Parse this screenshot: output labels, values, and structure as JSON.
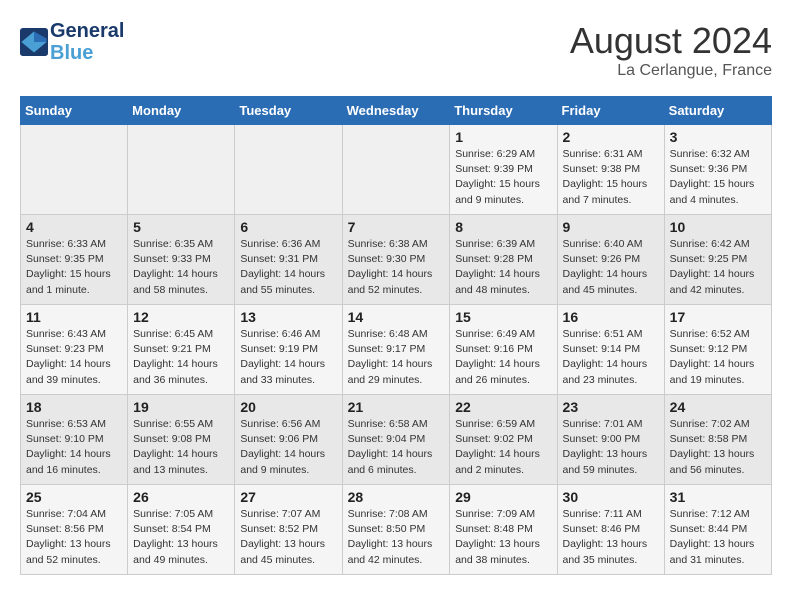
{
  "header": {
    "logo_line1": "General",
    "logo_line2": "Blue",
    "month": "August 2024",
    "location": "La Cerlangue, France"
  },
  "weekdays": [
    "Sunday",
    "Monday",
    "Tuesday",
    "Wednesday",
    "Thursday",
    "Friday",
    "Saturday"
  ],
  "weeks": [
    [
      {
        "day": "",
        "info": ""
      },
      {
        "day": "",
        "info": ""
      },
      {
        "day": "",
        "info": ""
      },
      {
        "day": "",
        "info": ""
      },
      {
        "day": "1",
        "info": "Sunrise: 6:29 AM\nSunset: 9:39 PM\nDaylight: 15 hours and 9 minutes."
      },
      {
        "day": "2",
        "info": "Sunrise: 6:31 AM\nSunset: 9:38 PM\nDaylight: 15 hours and 7 minutes."
      },
      {
        "day": "3",
        "info": "Sunrise: 6:32 AM\nSunset: 9:36 PM\nDaylight: 15 hours and 4 minutes."
      }
    ],
    [
      {
        "day": "4",
        "info": "Sunrise: 6:33 AM\nSunset: 9:35 PM\nDaylight: 15 hours and 1 minute."
      },
      {
        "day": "5",
        "info": "Sunrise: 6:35 AM\nSunset: 9:33 PM\nDaylight: 14 hours and 58 minutes."
      },
      {
        "day": "6",
        "info": "Sunrise: 6:36 AM\nSunset: 9:31 PM\nDaylight: 14 hours and 55 minutes."
      },
      {
        "day": "7",
        "info": "Sunrise: 6:38 AM\nSunset: 9:30 PM\nDaylight: 14 hours and 52 minutes."
      },
      {
        "day": "8",
        "info": "Sunrise: 6:39 AM\nSunset: 9:28 PM\nDaylight: 14 hours and 48 minutes."
      },
      {
        "day": "9",
        "info": "Sunrise: 6:40 AM\nSunset: 9:26 PM\nDaylight: 14 hours and 45 minutes."
      },
      {
        "day": "10",
        "info": "Sunrise: 6:42 AM\nSunset: 9:25 PM\nDaylight: 14 hours and 42 minutes."
      }
    ],
    [
      {
        "day": "11",
        "info": "Sunrise: 6:43 AM\nSunset: 9:23 PM\nDaylight: 14 hours and 39 minutes."
      },
      {
        "day": "12",
        "info": "Sunrise: 6:45 AM\nSunset: 9:21 PM\nDaylight: 14 hours and 36 minutes."
      },
      {
        "day": "13",
        "info": "Sunrise: 6:46 AM\nSunset: 9:19 PM\nDaylight: 14 hours and 33 minutes."
      },
      {
        "day": "14",
        "info": "Sunrise: 6:48 AM\nSunset: 9:17 PM\nDaylight: 14 hours and 29 minutes."
      },
      {
        "day": "15",
        "info": "Sunrise: 6:49 AM\nSunset: 9:16 PM\nDaylight: 14 hours and 26 minutes."
      },
      {
        "day": "16",
        "info": "Sunrise: 6:51 AM\nSunset: 9:14 PM\nDaylight: 14 hours and 23 minutes."
      },
      {
        "day": "17",
        "info": "Sunrise: 6:52 AM\nSunset: 9:12 PM\nDaylight: 14 hours and 19 minutes."
      }
    ],
    [
      {
        "day": "18",
        "info": "Sunrise: 6:53 AM\nSunset: 9:10 PM\nDaylight: 14 hours and 16 minutes."
      },
      {
        "day": "19",
        "info": "Sunrise: 6:55 AM\nSunset: 9:08 PM\nDaylight: 14 hours and 13 minutes."
      },
      {
        "day": "20",
        "info": "Sunrise: 6:56 AM\nSunset: 9:06 PM\nDaylight: 14 hours and 9 minutes."
      },
      {
        "day": "21",
        "info": "Sunrise: 6:58 AM\nSunset: 9:04 PM\nDaylight: 14 hours and 6 minutes."
      },
      {
        "day": "22",
        "info": "Sunrise: 6:59 AM\nSunset: 9:02 PM\nDaylight: 14 hours and 2 minutes."
      },
      {
        "day": "23",
        "info": "Sunrise: 7:01 AM\nSunset: 9:00 PM\nDaylight: 13 hours and 59 minutes."
      },
      {
        "day": "24",
        "info": "Sunrise: 7:02 AM\nSunset: 8:58 PM\nDaylight: 13 hours and 56 minutes."
      }
    ],
    [
      {
        "day": "25",
        "info": "Sunrise: 7:04 AM\nSunset: 8:56 PM\nDaylight: 13 hours and 52 minutes."
      },
      {
        "day": "26",
        "info": "Sunrise: 7:05 AM\nSunset: 8:54 PM\nDaylight: 13 hours and 49 minutes."
      },
      {
        "day": "27",
        "info": "Sunrise: 7:07 AM\nSunset: 8:52 PM\nDaylight: 13 hours and 45 minutes."
      },
      {
        "day": "28",
        "info": "Sunrise: 7:08 AM\nSunset: 8:50 PM\nDaylight: 13 hours and 42 minutes."
      },
      {
        "day": "29",
        "info": "Sunrise: 7:09 AM\nSunset: 8:48 PM\nDaylight: 13 hours and 38 minutes."
      },
      {
        "day": "30",
        "info": "Sunrise: 7:11 AM\nSunset: 8:46 PM\nDaylight: 13 hours and 35 minutes."
      },
      {
        "day": "31",
        "info": "Sunrise: 7:12 AM\nSunset: 8:44 PM\nDaylight: 13 hours and 31 minutes."
      }
    ]
  ]
}
